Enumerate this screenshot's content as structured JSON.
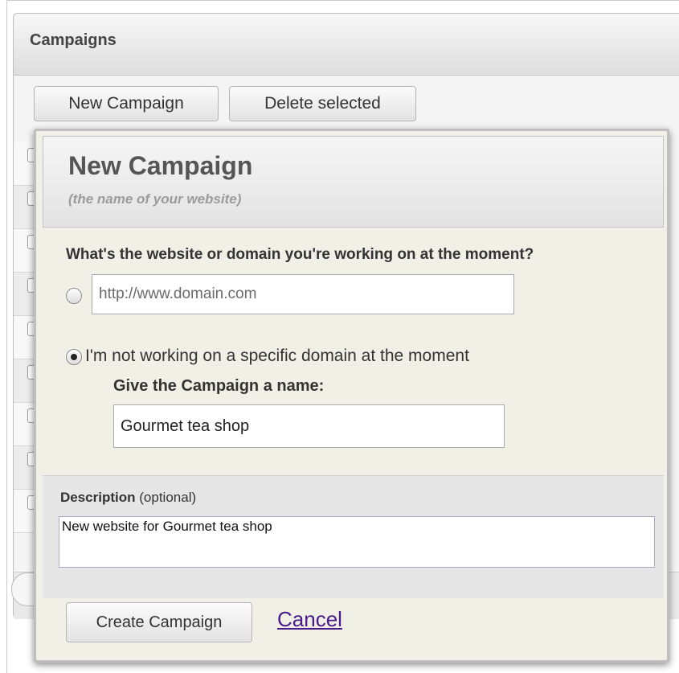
{
  "panel": {
    "title": "Campaigns"
  },
  "toolbar": {
    "new_campaign_label": "New Campaign",
    "delete_selected_label": "Delete selected"
  },
  "modal": {
    "title": "New Campaign",
    "subtitle": "(the name of your website)",
    "question": "What's the website or domain you're working on at the moment?",
    "domain_input": {
      "placeholder": "http://www.domain.com",
      "value": ""
    },
    "no_domain_option_label": "I'm not working on a specific domain at the moment",
    "name_label": "Give the Campaign a name:",
    "name_input": {
      "value": "Gourmet tea shop"
    },
    "description": {
      "label_bold": "Description",
      "label_suffix": " (optional)",
      "value": "New website for Gourmet tea shop"
    },
    "create_button_label": "Create Campaign",
    "cancel_link_label": "Cancel",
    "selected_option": "no_domain"
  },
  "colors": {
    "modal_background": "#f0f0e6",
    "cancel_link": "#4a1a8a",
    "panel_header": "#dedede"
  }
}
